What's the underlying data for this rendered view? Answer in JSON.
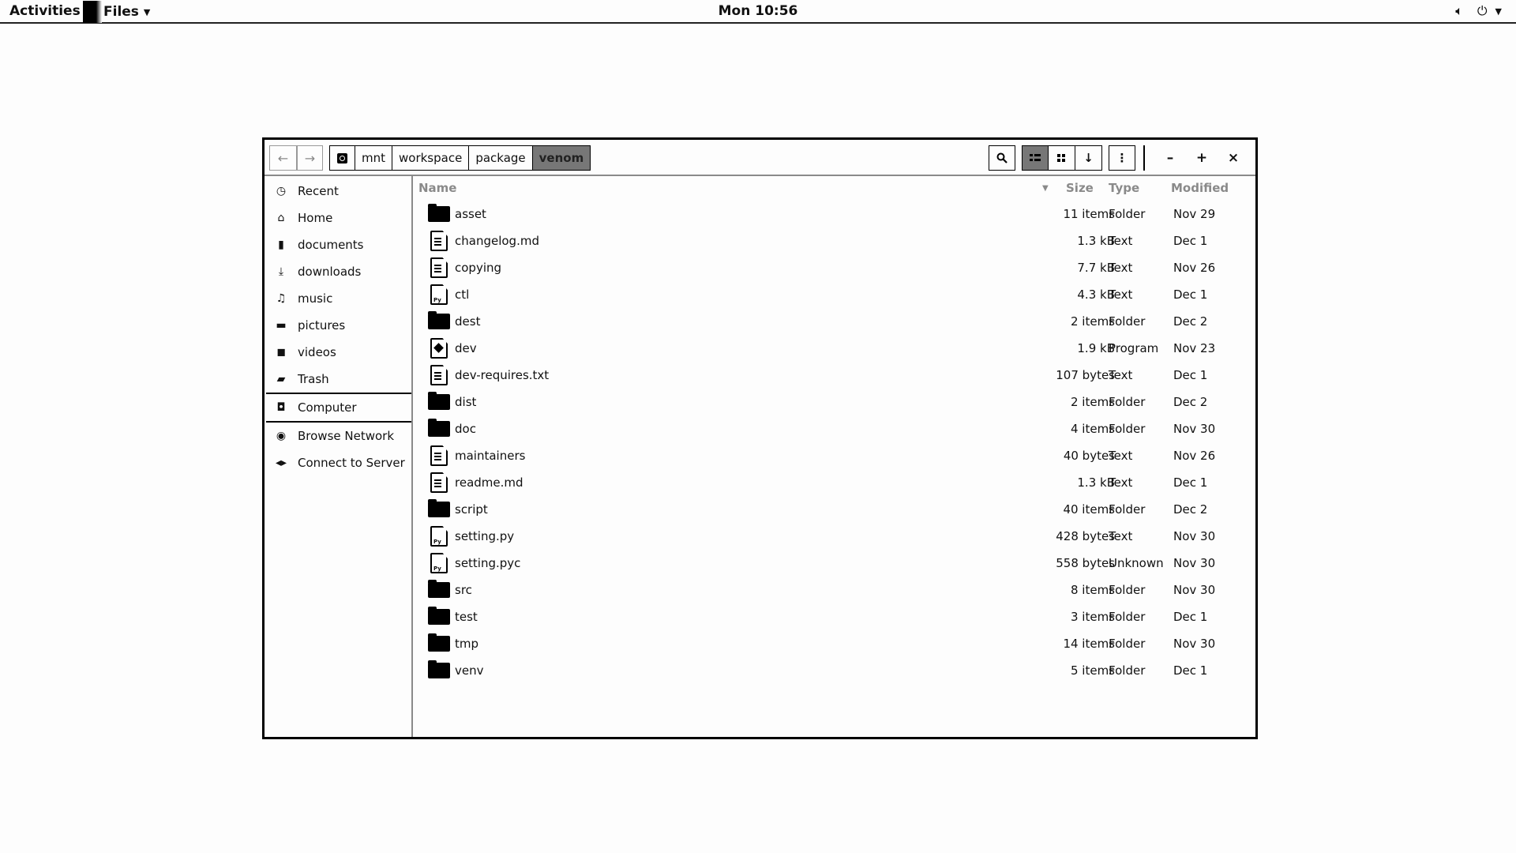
{
  "topbar": {
    "activities": "Activities",
    "app_name": "Files",
    "clock": "Mon 10:56",
    "icons": [
      "volume-icon",
      "power-icon",
      "chevron-down-icon"
    ]
  },
  "window": {
    "nav": {
      "back": "←",
      "forward": "→"
    },
    "path": [
      "mnt",
      "workspace",
      "package",
      "venom"
    ],
    "active_crumb": "venom",
    "toolbar": {
      "search": "search-icon",
      "list_view": "list-view-icon",
      "grid_view": "grid-view-icon",
      "sort": "sort-icon",
      "menu": "menu-icon",
      "minimize": "–",
      "maximize": "+",
      "close": "×"
    }
  },
  "sidebar": {
    "items": [
      {
        "label": "Recent",
        "icon": "clock-icon",
        "glyph": "◷"
      },
      {
        "label": "Home",
        "icon": "home-icon",
        "glyph": "⌂"
      },
      {
        "label": "documents",
        "icon": "document-icon",
        "glyph": "▮"
      },
      {
        "label": "downloads",
        "icon": "download-icon",
        "glyph": "⤓"
      },
      {
        "label": "music",
        "icon": "music-icon",
        "glyph": "♫"
      },
      {
        "label": "pictures",
        "icon": "picture-icon",
        "glyph": "▬"
      },
      {
        "label": "videos",
        "icon": "video-camera-icon",
        "glyph": "◼"
      },
      {
        "label": "Trash",
        "icon": "trash-icon",
        "glyph": "▰"
      },
      {
        "label": "Computer",
        "icon": "computer-icon",
        "glyph": "◘"
      },
      {
        "label": "Browse Network",
        "icon": "network-icon",
        "glyph": "◉"
      },
      {
        "label": "Connect to Server",
        "icon": "server-connect-icon",
        "glyph": "◂▸"
      }
    ]
  },
  "columns": {
    "name": "Name",
    "size": "Size",
    "type": "Type",
    "modified": "Modified"
  },
  "files": [
    {
      "name": "asset",
      "icon": "folder",
      "size": "11 items",
      "type": "Folder",
      "modified": "Nov 29"
    },
    {
      "name": "changelog.md",
      "icon": "text",
      "size": "1.3 kB",
      "type": "Text",
      "modified": "Dec 1"
    },
    {
      "name": "copying",
      "icon": "text",
      "size": "7.7 kB",
      "type": "Text",
      "modified": "Nov 26"
    },
    {
      "name": "ctl",
      "icon": "py",
      "size": "4.3 kB",
      "type": "Text",
      "modified": "Dec 1"
    },
    {
      "name": "dest",
      "icon": "folder",
      "size": "2 items",
      "type": "Folder",
      "modified": "Dec 2"
    },
    {
      "name": "dev",
      "icon": "prog",
      "size": "1.9 kB",
      "type": "Program",
      "modified": "Nov 23"
    },
    {
      "name": "dev-requires.txt",
      "icon": "text",
      "size": "107 bytes",
      "type": "Text",
      "modified": "Dec 1"
    },
    {
      "name": "dist",
      "icon": "folder",
      "size": "2 items",
      "type": "Folder",
      "modified": "Dec 2"
    },
    {
      "name": "doc",
      "icon": "folder",
      "size": "4 items",
      "type": "Folder",
      "modified": "Nov 30"
    },
    {
      "name": "maintainers",
      "icon": "text",
      "size": "40 bytes",
      "type": "Text",
      "modified": "Nov 26"
    },
    {
      "name": "readme.md",
      "icon": "text",
      "size": "1.3 kB",
      "type": "Text",
      "modified": "Dec 1"
    },
    {
      "name": "script",
      "icon": "folder",
      "size": "40 items",
      "type": "Folder",
      "modified": "Dec 2"
    },
    {
      "name": "setting.py",
      "icon": "py",
      "size": "428 bytes",
      "type": "Text",
      "modified": "Nov 30"
    },
    {
      "name": "setting.pyc",
      "icon": "py",
      "size": "558 bytes",
      "type": "Unknown",
      "modified": "Nov 30"
    },
    {
      "name": "src",
      "icon": "folder",
      "size": "8 items",
      "type": "Folder",
      "modified": "Nov 30"
    },
    {
      "name": "test",
      "icon": "folder",
      "size": "3 items",
      "type": "Folder",
      "modified": "Dec 1"
    },
    {
      "name": "tmp",
      "icon": "folder",
      "size": "14 items",
      "type": "Folder",
      "modified": "Nov 30"
    },
    {
      "name": "venv",
      "icon": "folder",
      "size": "5 items",
      "type": "Folder",
      "modified": "Dec 1"
    }
  ]
}
